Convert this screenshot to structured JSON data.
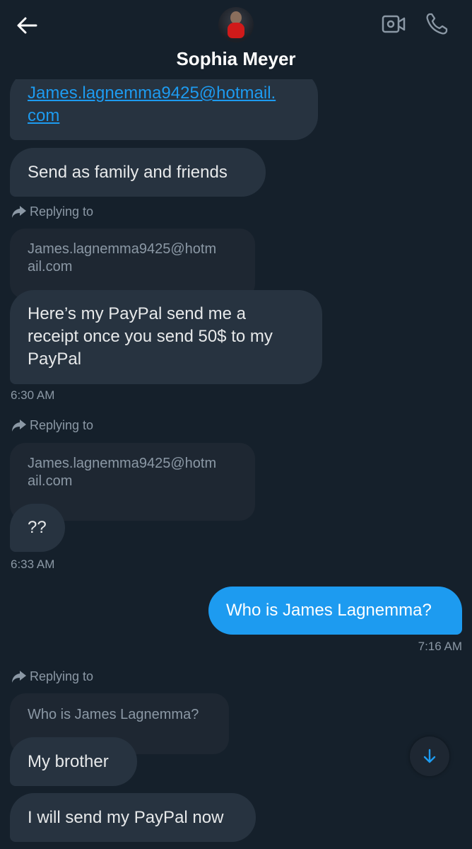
{
  "header": {
    "contact_name": "Sophia Meyer"
  },
  "messages": {
    "m1_link": "James.lagnemma9425@hotmail.",
    "m1_link_cont": "com",
    "m2": "Send as family and friends",
    "reply_label": "Replying to",
    "q1_line1": "James.lagnemma9425@hotm",
    "q1_line2": "ail.com",
    "m3_line1": "Here’s my PayPal send me a",
    "m3_line2": "receipt once you send 50$ to my",
    "m3_line3": "PayPal",
    "t1": "6:30 AM",
    "q2_line1": "James.lagnemma9425@hotm",
    "q2_line2": "ail.com",
    "m4": "??",
    "t2": "6:33 AM",
    "out1": "Who is James Lagnemma?",
    "t3": "7:16 AM",
    "q3": "Who is James Lagnemma?",
    "m5": "My brother",
    "m6": "I will send my PayPal now"
  },
  "colors": {
    "background": "#15202b",
    "incoming_bubble": "#273340",
    "outgoing_bubble": "#1d9bf0",
    "quote_bubble": "#1e2732",
    "muted_text": "#8b98a5"
  },
  "icons": [
    "back-arrow-icon",
    "video-call-icon",
    "phone-icon",
    "reply-arrow-icon",
    "arrow-down-icon"
  ]
}
